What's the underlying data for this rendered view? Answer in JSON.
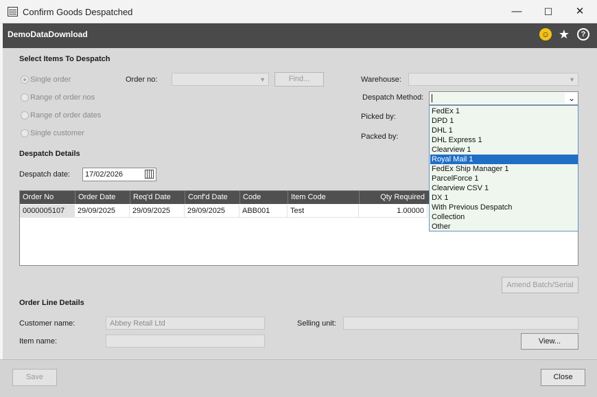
{
  "window": {
    "title": "Confirm Goods Despatched",
    "minimize": "—",
    "maximize": "☐",
    "close": "✕"
  },
  "header": {
    "app_name": "DemoDataDownload",
    "icons": [
      "smiley-icon",
      "star-icon",
      "help-icon"
    ]
  },
  "select_items": {
    "heading": "Select Items To Despatch",
    "radios": [
      {
        "label": "Single order",
        "checked": true
      },
      {
        "label": "Range of order nos",
        "checked": false
      },
      {
        "label": "Range of order dates",
        "checked": false
      },
      {
        "label": "Single customer",
        "checked": false
      }
    ],
    "order_no_label": "Order no:",
    "order_no_value": "",
    "find_label": "Find...",
    "warehouse_label": "Warehouse:",
    "warehouse_value": "",
    "despatch_method_label": "Despatch Method:",
    "despatch_method_value": "",
    "picked_by_label": "Picked by:",
    "packed_by_label": "Packed by:"
  },
  "despatch_methods": [
    "FedEx 1",
    "DPD 1",
    "DHL 1",
    "DHL Express 1",
    "Clearview 1",
    "Royal Mail 1",
    "FedEx Ship Manager 1",
    "ParcelForce 1",
    "Clearview CSV 1",
    "DX 1",
    "With Previous Despatch",
    "Collection",
    "Other"
  ],
  "despatch_methods_selected": "Royal Mail 1",
  "despatch_details": {
    "heading": "Despatch Details",
    "date_label": "Despatch date:",
    "date_value": "17/02/2026"
  },
  "grid": {
    "columns": [
      "Order No",
      "Order Date",
      "Req'd Date",
      "Conf'd Date",
      "Code",
      "Item Code",
      "Qty Required"
    ],
    "rows": [
      [
        "0000005107",
        "29/09/2025",
        "29/09/2025",
        "29/09/2025",
        "ABB001",
        "Test",
        "1.00000"
      ]
    ]
  },
  "amend_label": "Amend Batch/Serial",
  "order_line": {
    "heading": "Order Line Details",
    "customer_label": "Customer name:",
    "customer_value": "Abbey Retail Ltd",
    "item_label": "Item name:",
    "item_value": "",
    "selling_unit_label": "Selling unit:",
    "selling_unit_value": "",
    "view_label": "View..."
  },
  "footer": {
    "save_label": "Save",
    "close_label": "Close"
  },
  "colors": {
    "header_band": "#4a4a4a",
    "grid_header": "#505050",
    "selection": "#1f6fc5",
    "dropdown_bg": "#eef6ee",
    "smiley": "#f2c21b"
  }
}
